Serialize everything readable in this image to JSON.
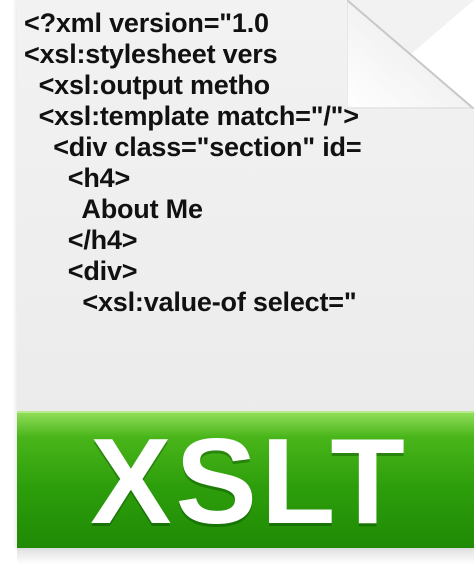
{
  "code_lines": [
    "<?xml version=\"1.0",
    "<xsl:stylesheet vers",
    "  <xsl:output metho",
    "  <xsl:template match=\"/\">",
    "    <div class=\"section\" id=",
    "      <h4>",
    "        About Me",
    "      </h4>",
    "      <div>",
    "        <xsl:value-of select=\""
  ],
  "banner": {
    "label": "XSLT"
  },
  "colors": {
    "banner_green": "#2d9e0b",
    "banner_text": "#ffffff",
    "code_text": "#111111",
    "page_background": "#f0f0f0"
  },
  "icons": {
    "corner": "folded-corner-icon"
  }
}
